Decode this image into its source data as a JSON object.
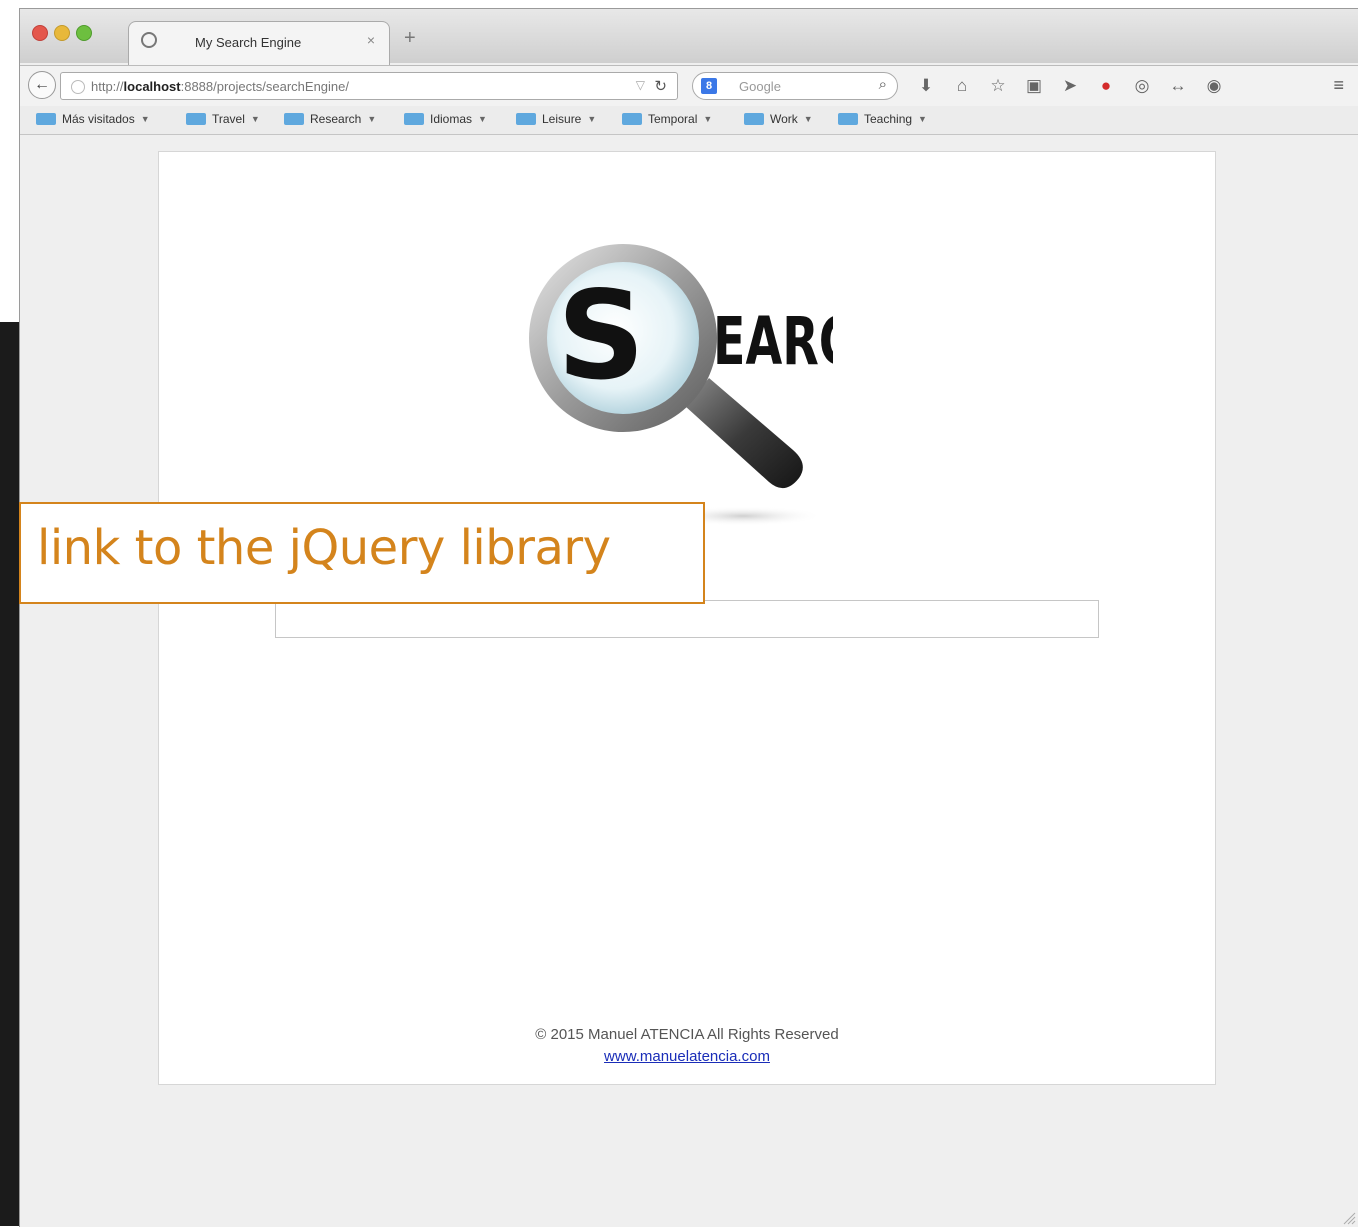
{
  "editor": {
    "code_fragment_1": "/>"
  },
  "browser": {
    "tab_title": "My Search Engine",
    "tab_close": "×",
    "new_tab": "+",
    "url_prefix": "http://",
    "url_host": "localhost",
    "url_rest": ":8888/projects/searchEngine/",
    "search_placeholder": "Google",
    "search_engine_badge": "8"
  },
  "bookmarks": [
    {
      "label": "Más visitados"
    },
    {
      "label": "Travel"
    },
    {
      "label": "Research"
    },
    {
      "label": "Idiomas"
    },
    {
      "label": "Leisure"
    },
    {
      "label": "Temporal"
    },
    {
      "label": "Work"
    },
    {
      "label": "Teaching"
    }
  ],
  "page": {
    "logo_letter": "S",
    "logo_text": "EARCH",
    "footer_copyright": "© 2015 Manuel ATENCIA All Rights Reserved",
    "footer_link": "www.manuelatencia.com"
  },
  "callout": {
    "text": "link to the jQuery library"
  },
  "icons": [
    "back-arrow-icon",
    "reload-icon",
    "search-icon",
    "download-icon",
    "home-icon",
    "star-icon",
    "clipboard-icon",
    "send-icon",
    "adblock-icon",
    "extension-icon",
    "menu-icon"
  ],
  "colors": {
    "callout": "#d4841c",
    "link": "#1a2db8",
    "editor_bg": "#1b1b1b"
  }
}
